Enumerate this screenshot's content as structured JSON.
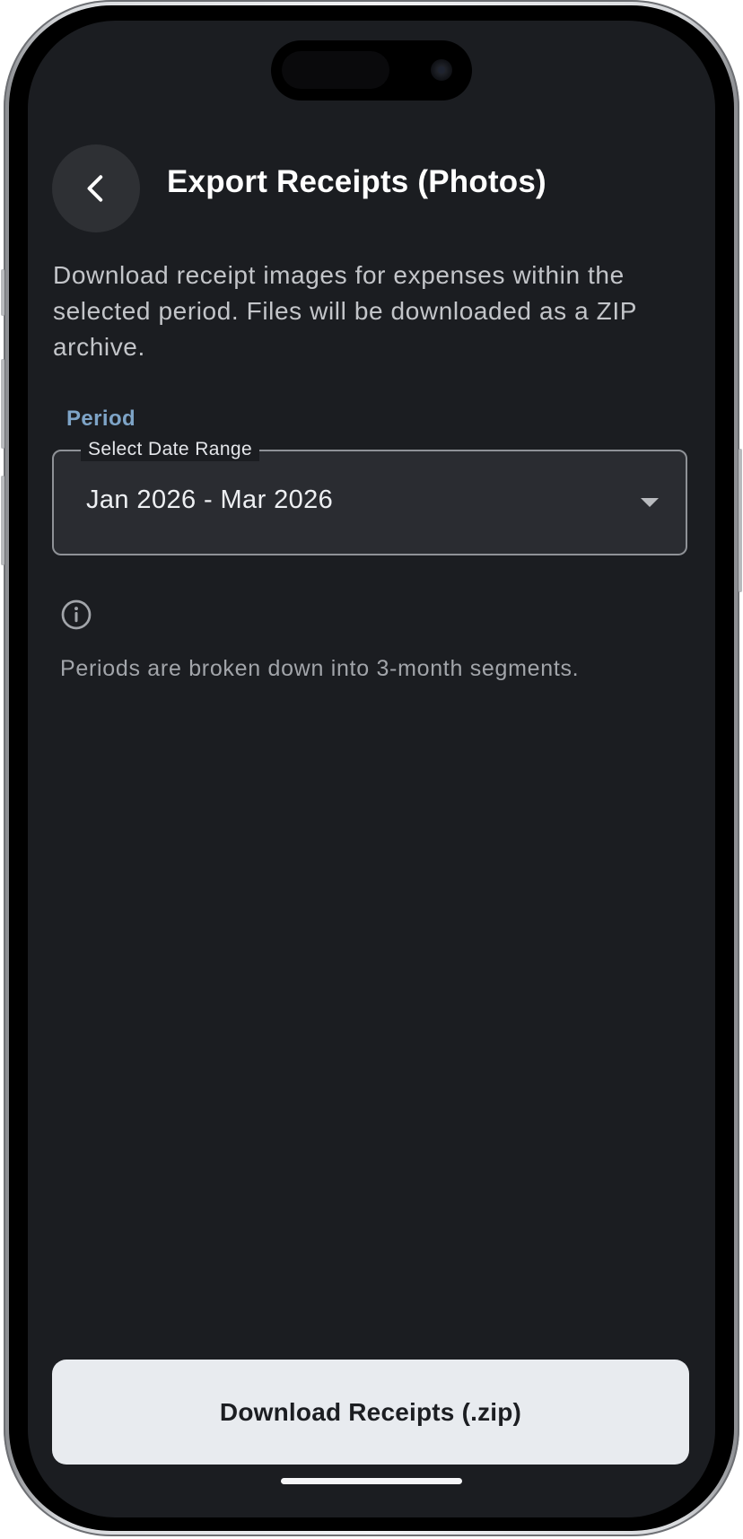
{
  "header": {
    "title": "Export Receipts (Photos)",
    "back_icon": "chevron-left-icon"
  },
  "description": "Download receipt images for expenses within the selected period. Files will be downloaded as a ZIP archive.",
  "period": {
    "section_label": "Period",
    "field_label": "Select Date Range",
    "selected_value": "Jan 2026 - Mar 2026",
    "dropdown_icon": "caret-down-icon"
  },
  "info": {
    "icon": "info-icon",
    "text": "Periods are broken down into 3-month segments."
  },
  "actions": {
    "download_label": "Download Receipts (.zip)"
  },
  "colors": {
    "background": "#1b1d21",
    "accent": "#7ea4c7",
    "button_bg": "#e8ebef"
  }
}
